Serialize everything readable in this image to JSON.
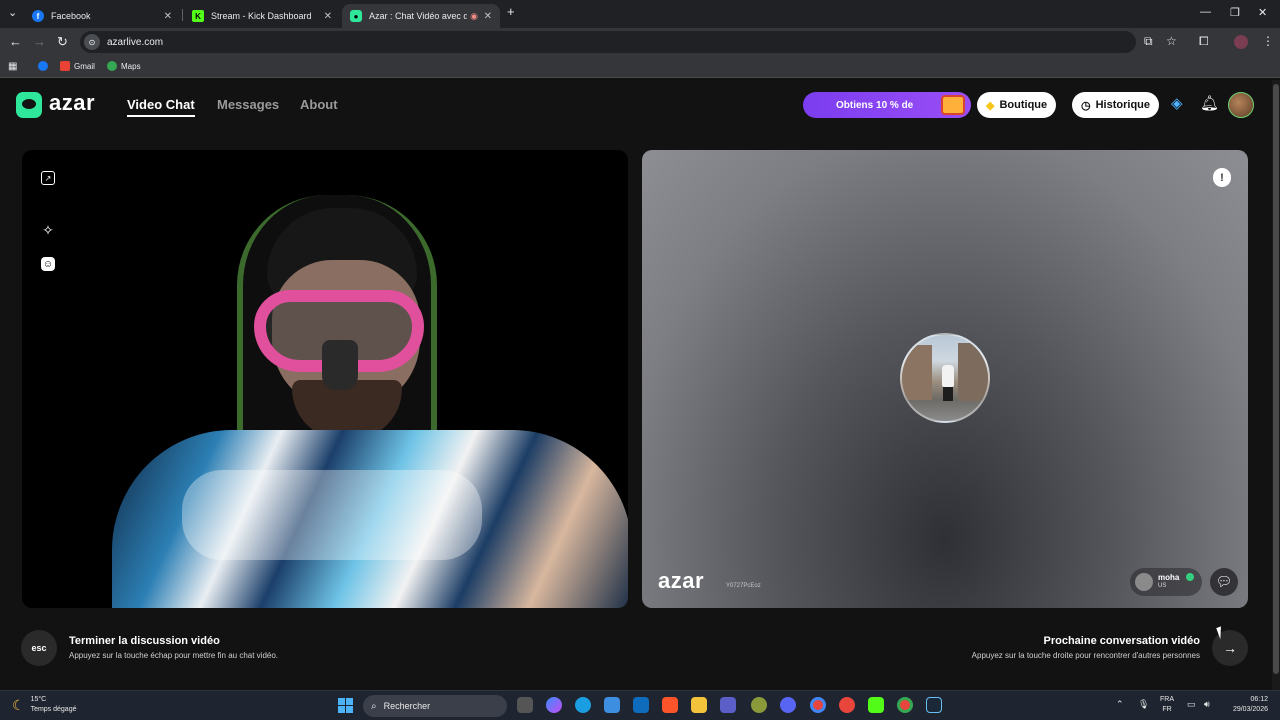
{
  "browser": {
    "tabs": [
      {
        "title": "Facebook",
        "icon": "facebook-icon"
      },
      {
        "title": "Stream - Kick Dashboard",
        "icon": "kick-icon"
      },
      {
        "title": "Azar : Chat Vidéo avec de n",
        "icon": "azar-icon"
      }
    ],
    "url": "azarlive.com",
    "bookmarks": [
      "Gmail",
      "Maps"
    ]
  },
  "header": {
    "logo": "azar",
    "nav": [
      "Video Chat",
      "Messages",
      "About"
    ],
    "promo": "Obtiens 10 % de",
    "shop": "Boutique",
    "history": "Historique"
  },
  "remote": {
    "watermark": "azar",
    "id": "Y0727PcEoz",
    "username": "moha",
    "country": "US"
  },
  "actions": {
    "esc_key": "esc",
    "end_title": "Terminer la discussion vidéo",
    "end_sub": "Appuyez sur la touche échap pour mettre fin au chat vidéo.",
    "next_title": "Prochaine conversation vidéo",
    "next_sub": "Appuyez sur la touche droite pour rencontrer d'autres personnes"
  },
  "taskbar": {
    "temp": "15°C",
    "weather": "Temps dégagé",
    "search_placeholder": "Rechercher",
    "lang": "FRA",
    "lang2": "FR",
    "time": "06:12",
    "date": "29/03/2026"
  },
  "colors": {
    "accent": "#2fe79a",
    "promo": "#8a45f3"
  }
}
